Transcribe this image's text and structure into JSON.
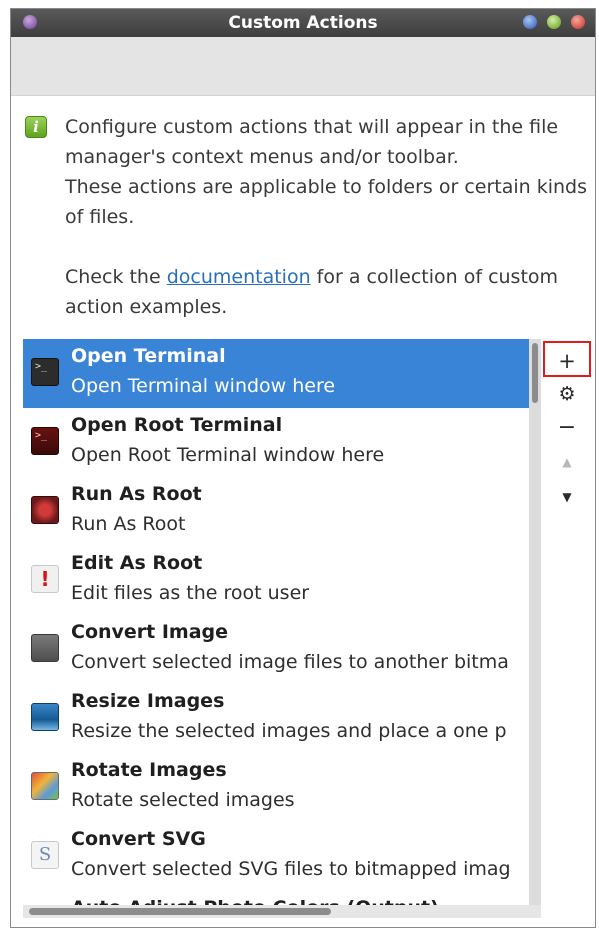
{
  "window": {
    "title": "Custom Actions"
  },
  "info": {
    "line1": "Configure custom actions that will appear in the file manager's context menus and/or toolbar.",
    "line2": "These actions are applicable to folders or certain kinds of files.",
    "check_prefix": "Check the ",
    "doc_link": "documentation",
    "check_suffix": " for a collection of custom action examples."
  },
  "actions": [
    {
      "title": "Open Terminal",
      "description": "Open Terminal window here",
      "icon": "terminal-icon"
    },
    {
      "title": "Open Root Terminal",
      "description": "Open Root Terminal window here",
      "icon": "root-terminal-icon"
    },
    {
      "title": "Run As Root",
      "description": "Run As Root",
      "icon": "run-as-root-icon"
    },
    {
      "title": "Edit As Root",
      "description": "Edit files as the root user",
      "icon": "warning-icon"
    },
    {
      "title": "Convert Image",
      "description": "Convert selected image files to another bitma",
      "icon": "image-convert-icon"
    },
    {
      "title": "Resize Images",
      "description": "Resize the selected images and place a one p",
      "icon": "resize-image-icon"
    },
    {
      "title": "Rotate Images",
      "description": "Rotate selected images",
      "icon": "rotate-image-icon"
    },
    {
      "title": "Convert SVG",
      "description": "Convert selected SVG files to bitmapped imag",
      "icon": "svg-icon"
    },
    {
      "title": "Auto Adjust Photo Colors (Output)",
      "description": "",
      "icon": "photo-icon"
    }
  ],
  "selected_index": 0,
  "sidebar": {
    "add_label": "+",
    "prefs_label": "⚙",
    "remove_label": "−",
    "up_label": "▲",
    "down_label": "▼"
  },
  "colors": {
    "selection": "#3a84d8",
    "link": "#2a6fbb",
    "highlight_border": "#e01b1b"
  }
}
